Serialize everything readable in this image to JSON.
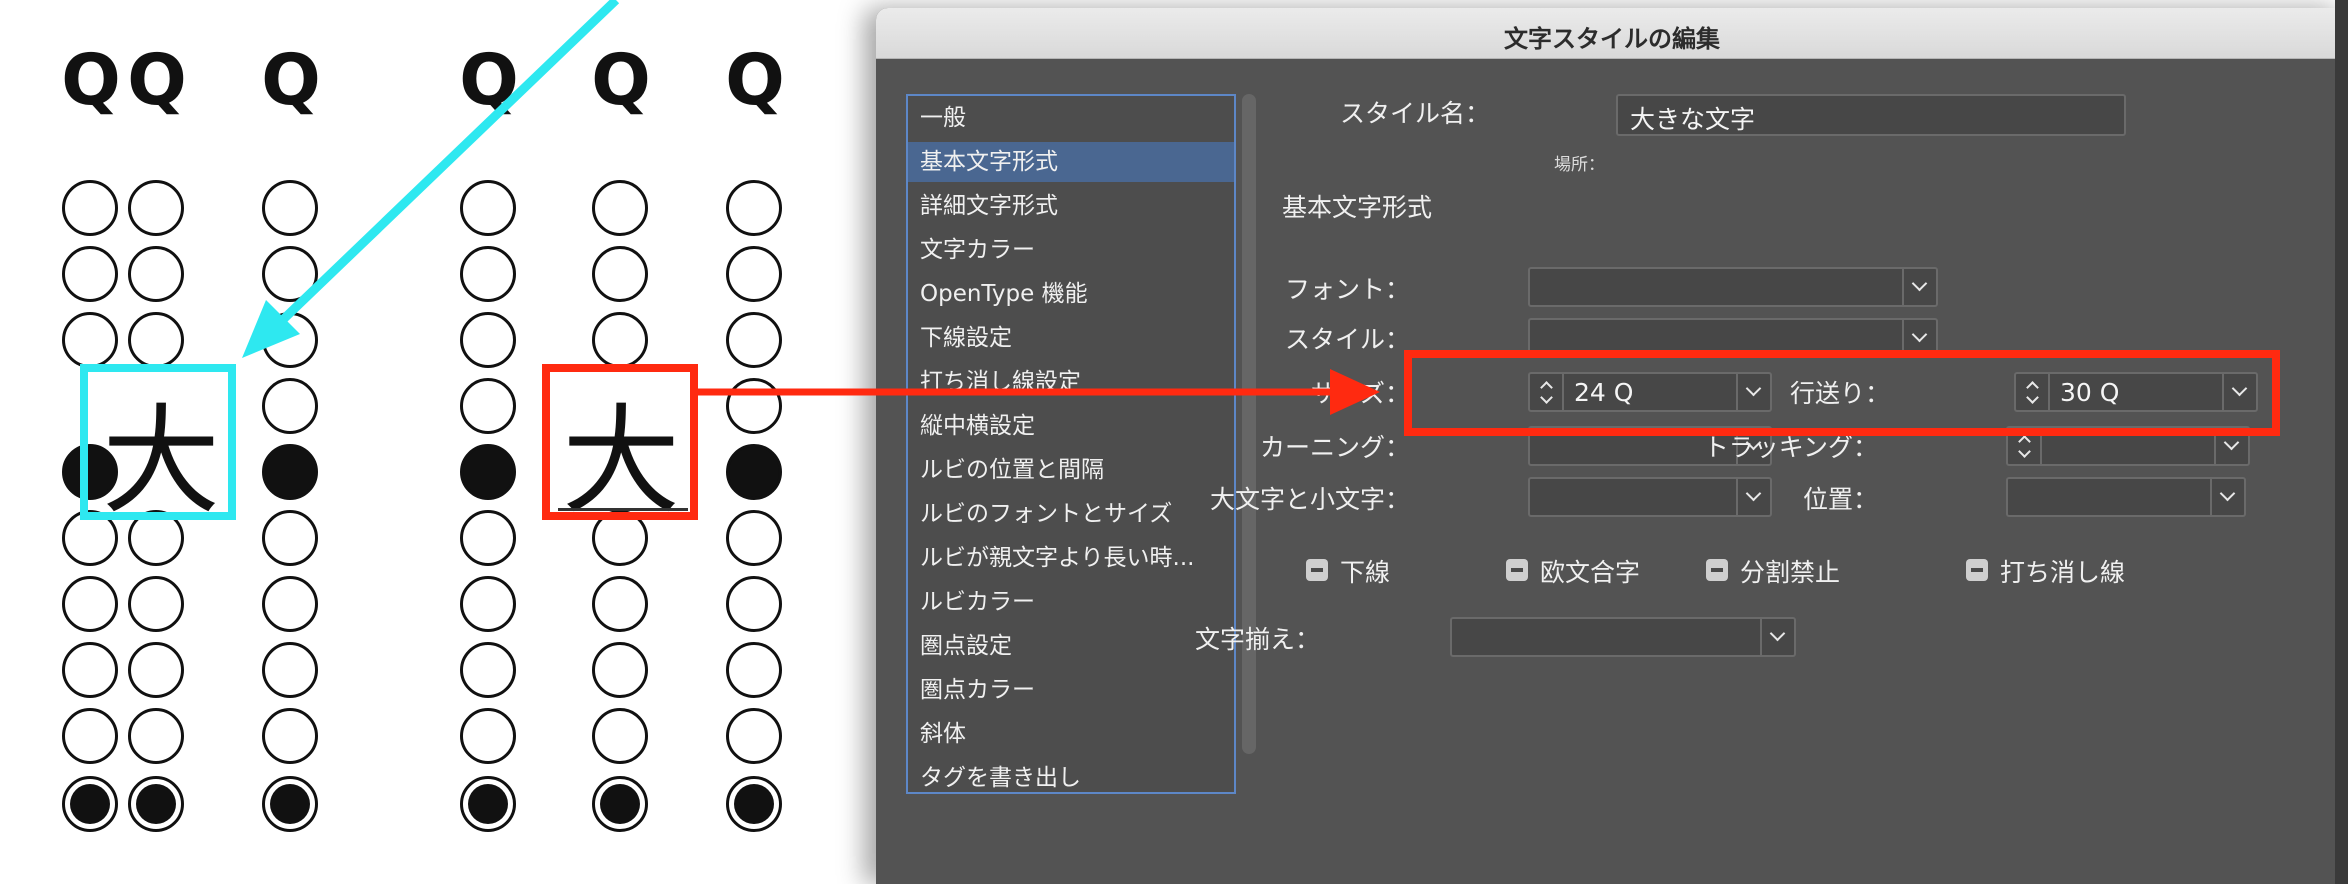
{
  "document": {
    "q_glyph": "Q",
    "big_glyph": "大"
  },
  "dialog": {
    "title": "文字スタイルの編集",
    "categories": [
      "一般",
      "基本文字形式",
      "詳細文字形式",
      "文字カラー",
      "OpenType 機能",
      "下線設定",
      "打ち消し線設定",
      "縦中横設定",
      "ルビの位置と間隔",
      "ルビのフォントとサイズ",
      "ルビが親文字より長い時...",
      "ルビカラー",
      "圏点設定",
      "圏点カラー",
      "斜体",
      "タグを書き出し"
    ],
    "selected_category": "基本文字形式",
    "style_name_label": "スタイル名：",
    "style_name_value": "大きな文字",
    "location_label": "場所：",
    "section_title": "基本文字形式",
    "font_label": "フォント：",
    "font_value": "",
    "style_label": "スタイル：",
    "style_value": "",
    "size_label": "サイズ：",
    "size_value": "24 Q",
    "leading_label": "行送り：",
    "leading_value": "30 Q",
    "kerning_label": "カーニング：",
    "kerning_value": "",
    "tracking_label": "トラッキング：",
    "tracking_value": "",
    "case_label": "大文字と小文字：",
    "case_value": "",
    "position_label": "位置：",
    "position_value": "",
    "checkboxes": [
      "下線",
      "欧文合字",
      "分割禁止",
      "打ち消し線"
    ],
    "alignment_label": "文字揃え：",
    "alignment_value": ""
  },
  "colors": {
    "cyan_highlight": "#2ee8f0",
    "red_highlight": "#ff2a10",
    "dialog_bg": "#535353",
    "selection": "#4a6791"
  }
}
